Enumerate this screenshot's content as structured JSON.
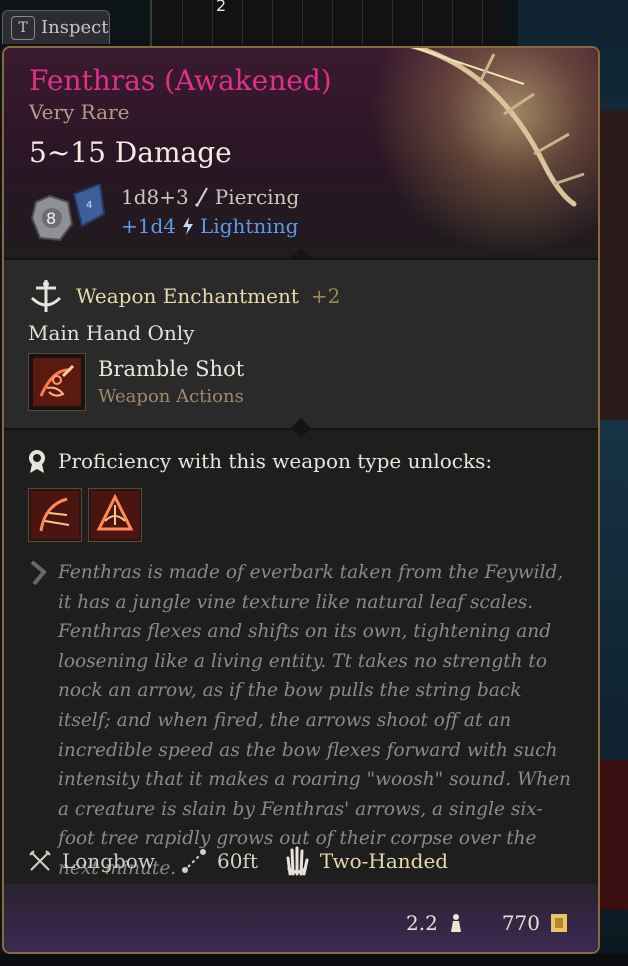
{
  "inspect": {
    "key": "T",
    "label": "Inspect"
  },
  "background": {
    "grid_count": "2"
  },
  "item": {
    "name": "Fenthras (Awakened)",
    "rarity": "Very Rare",
    "damage_range": "5~15 Damage",
    "die_face": "8",
    "damage_primary": {
      "dice": "1d8+3",
      "type": "Piercing"
    },
    "damage_bonus": {
      "dice": "+1d4",
      "type": "Lightning"
    }
  },
  "enchantment": {
    "label": "Weapon Enchantment",
    "bonus": "+2"
  },
  "main_hand": "Main Hand Only",
  "action": {
    "name": "Bramble Shot",
    "category": "Weapon Actions"
  },
  "proficiency": {
    "label": "Proficiency with this weapon type unlocks:"
  },
  "description": "Fenthras is made of everbark taken from the Feywild, it has a jungle vine texture like natural leaf scales. Fenthras flexes and shifts on its own, tightening and loosening like a living entity. Tt takes no strength to nock an arrow, as if the bow pulls the string back itself; and when fired, the arrows shoot off at an incredible speed as the bow flexes forward with such intensity that it makes a roaring \"woosh\" sound. When a creature is slain by Fenthras' arrows, a single six-foot tree rapidly grows out of their corpse over the next minute.",
  "properties": {
    "type": "Longbow",
    "range": "60ft",
    "handedness": "Two-Handed"
  },
  "footer": {
    "weight": "2.2",
    "value": "770"
  },
  "colors": {
    "name": "#e0308a",
    "rarity": "#b89a8a",
    "lightning": "#5b9be8",
    "enchant": "#e9d9a7",
    "border": "#8a6a3a",
    "footer": "#3a2a52"
  },
  "icons": [
    "weapon-enchant-icon",
    "piercing-icon",
    "lightning-icon",
    "bramble-shot-icon",
    "proficiency-icon",
    "lore-icon",
    "longbow-icon",
    "range-icon",
    "two-handed-icon",
    "weight-icon",
    "gold-icon",
    "bow-art",
    "dice-icon"
  ]
}
